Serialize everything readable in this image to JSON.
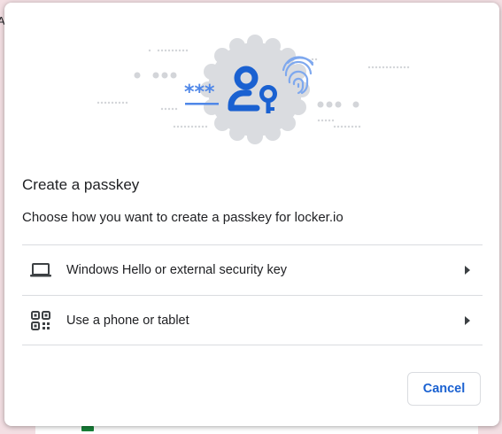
{
  "background": {
    "partial_text": "A"
  },
  "dialog": {
    "title": "Create a passkey",
    "subtitle": "Choose how you want to create a passkey for locker.io",
    "options": [
      {
        "label": "Windows Hello or external security key",
        "icon": "laptop-icon"
      },
      {
        "label": "Use a phone or tablet",
        "icon": "qr-code-icon"
      }
    ],
    "cancel_label": "Cancel",
    "hero": {
      "password_mask": "***",
      "icons": [
        "user-key-icon",
        "fingerprint-icon"
      ]
    }
  },
  "colors": {
    "accent_blue": "#1a61d1",
    "badge_gray": "#dadce0",
    "text": "#202124",
    "divider": "#dadce0"
  }
}
